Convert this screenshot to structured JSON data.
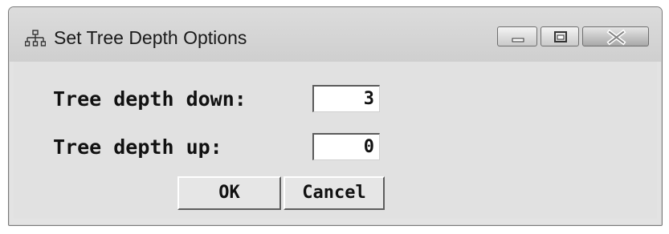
{
  "window": {
    "title": "Set Tree Depth Options",
    "icon": "tree-hierarchy-icon",
    "controls": {
      "minimize": "minimize-icon",
      "maximize": "maximize-icon",
      "close": "close-icon"
    }
  },
  "form": {
    "depth_down_label": "Tree depth down:",
    "depth_down_value": "3",
    "depth_up_label": "Tree depth up:",
    "depth_up_value": "0"
  },
  "buttons": {
    "ok_label": "OK",
    "cancel_label": "Cancel"
  },
  "colors": {
    "window_bg": "#e3e3e3",
    "field_bg": "#ffffff",
    "text": "#111111"
  }
}
